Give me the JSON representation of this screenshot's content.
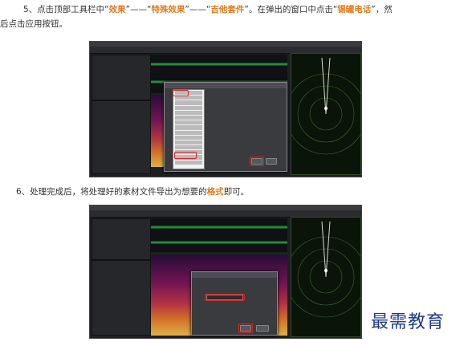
{
  "step5": {
    "prefix": "5、点击顶部工具栏中“",
    "effect": "效果",
    "sep1": "”——“",
    "special": "特殊效果",
    "sep2": "”——“",
    "guitar": "吉他套件",
    "mid": "”。在弹出的窗口中点击“",
    "can": "锡罐电话",
    "suffix": "”，然",
    "line2": "后点击应用按钮。"
  },
  "step6": {
    "prefix": "6、处理完成后，将处理好的素材文件导出为想要的",
    "format": "格式",
    "suffix": "即可。"
  },
  "watermark": "最需教育",
  "colors": {
    "highlight": "#e07b1f",
    "annotation": "#e02020",
    "logo": "#1f3a8a"
  }
}
